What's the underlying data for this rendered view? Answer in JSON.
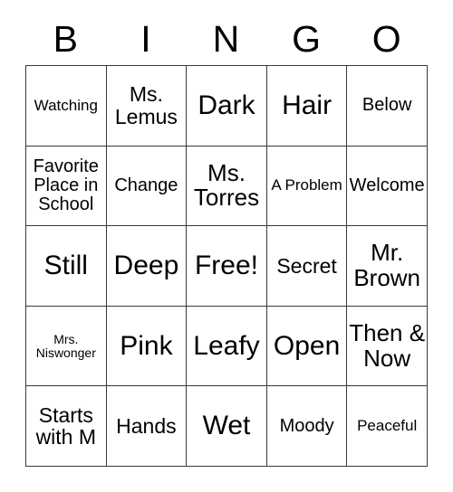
{
  "card": {
    "type": "bingo-card",
    "headers": [
      "B",
      "I",
      "N",
      "G",
      "O"
    ],
    "columns": 5,
    "rows": 5,
    "border_color": "#3a3a3a",
    "background_color": "#ffffff",
    "text_color": "#000000",
    "free_space": {
      "row": 3,
      "column": 3,
      "label": "Free!"
    },
    "cells": [
      [
        {
          "label": "Watching",
          "size": "sm"
        },
        {
          "label": "Ms. Lemus",
          "size": "lg"
        },
        {
          "label": "Dark",
          "size": "xxl"
        },
        {
          "label": "Hair",
          "size": "xxl"
        },
        {
          "label": "Below",
          "size": "md"
        }
      ],
      [
        {
          "label": "Favorite Place in School",
          "size": "md"
        },
        {
          "label": "Change",
          "size": "md"
        },
        {
          "label": "Ms. Torres",
          "size": "xl"
        },
        {
          "label": "A Problem",
          "size": "sm"
        },
        {
          "label": "Welcome",
          "size": "md"
        }
      ],
      [
        {
          "label": "Still",
          "size": "xxl"
        },
        {
          "label": "Deep",
          "size": "xxl"
        },
        {
          "label": "Free!",
          "size": "xxl"
        },
        {
          "label": "Secret",
          "size": "lg"
        },
        {
          "label": "Mr. Brown",
          "size": "xl"
        }
      ],
      [
        {
          "label": "Mrs. Niswonger",
          "size": "xs"
        },
        {
          "label": "Pink",
          "size": "xxl"
        },
        {
          "label": "Leafy",
          "size": "xxl"
        },
        {
          "label": "Open",
          "size": "xxl"
        },
        {
          "label": "Then & Now",
          "size": "xl"
        }
      ],
      [
        {
          "label": "Starts with M",
          "size": "lg"
        },
        {
          "label": "Hands",
          "size": "lg"
        },
        {
          "label": "Wet",
          "size": "xxl"
        },
        {
          "label": "Moody",
          "size": "md"
        },
        {
          "label": "Peaceful",
          "size": "sm"
        }
      ]
    ]
  }
}
